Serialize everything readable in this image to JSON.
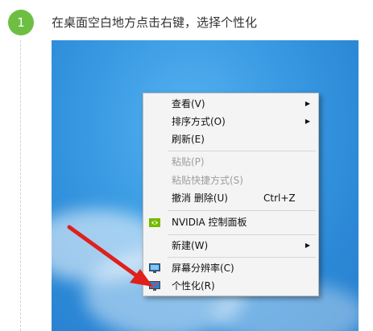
{
  "step": {
    "number": "1",
    "instruction": "在桌面空白地方点击右键，选择个性化"
  },
  "menu": {
    "items": [
      {
        "label": "查看(V)",
        "has_submenu": true,
        "disabled": false
      },
      {
        "label": "排序方式(O)",
        "has_submenu": true,
        "disabled": false
      },
      {
        "label": "刷新(E)",
        "has_submenu": false,
        "disabled": false
      },
      {
        "label": "粘贴(P)",
        "has_submenu": false,
        "disabled": true
      },
      {
        "label": "粘贴快捷方式(S)",
        "has_submenu": false,
        "disabled": true
      },
      {
        "label": "撤消 删除(U)",
        "shortcut": "Ctrl+Z",
        "has_submenu": false,
        "disabled": false
      },
      {
        "label": "NVIDIA 控制面板",
        "icon": "nvidia-icon",
        "has_submenu": false,
        "disabled": false
      },
      {
        "label": "新建(W)",
        "has_submenu": true,
        "disabled": false
      },
      {
        "label": "屏幕分辨率(C)",
        "icon": "screen-resolution-icon",
        "has_submenu": false,
        "disabled": false
      },
      {
        "label": "个性化(R)",
        "icon": "personalize-icon",
        "has_submenu": false,
        "disabled": false
      }
    ]
  },
  "colors": {
    "step_badge": "#6fbe44",
    "desktop": "#3a9be3",
    "arrow": "#e0201c",
    "nvidia": "#76b900"
  }
}
